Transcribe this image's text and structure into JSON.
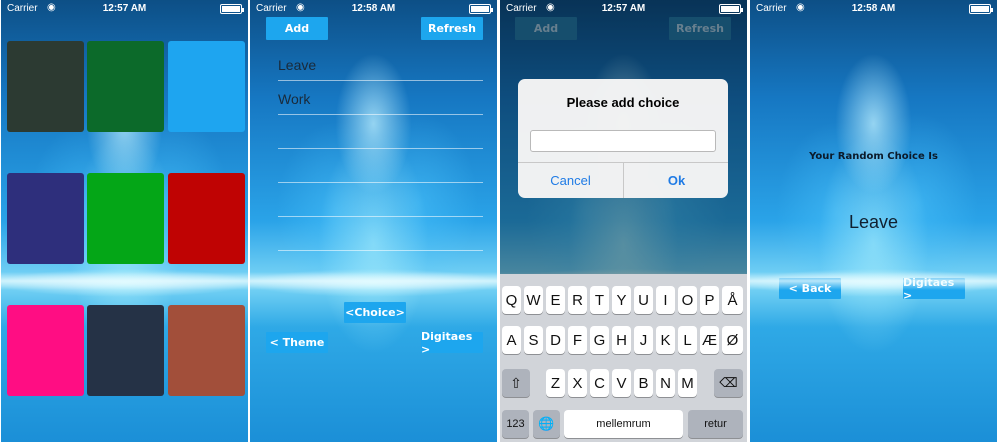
{
  "statusbar": {
    "carrier": "Carrier",
    "wifi_icon": "wifi-icon",
    "times": [
      "12:57 AM",
      "12:58 AM",
      "12:57 AM",
      "12:58 AM"
    ]
  },
  "screen1": {
    "swatches": [
      "#2c3a32",
      "#0c6a2a",
      "#1ea5f0",
      "#2e2f7c",
      "#04a617",
      "#bf0303",
      "#ff0d83",
      "#253246",
      "#a24f3a"
    ]
  },
  "screen2": {
    "add_label": "Add",
    "refresh_label": "Refresh",
    "items": [
      "Leave",
      "Work"
    ],
    "choice_label": "<Choice>",
    "theme_label": "< Theme",
    "digitaes_label": "Digitaes >"
  },
  "screen3": {
    "add_label": "Add",
    "refresh_label": "Refresh",
    "alert": {
      "title": "Please add choice",
      "input_value": "",
      "cancel_label": "Cancel",
      "ok_label": "Ok"
    },
    "keyboard": {
      "row1": [
        "Q",
        "W",
        "E",
        "R",
        "T",
        "Y",
        "U",
        "I",
        "O",
        "P",
        "Å"
      ],
      "row2": [
        "A",
        "S",
        "D",
        "F",
        "G",
        "H",
        "J",
        "K",
        "L",
        "Æ",
        "Ø"
      ],
      "row3": [
        "Z",
        "X",
        "C",
        "V",
        "B",
        "N",
        "M"
      ],
      "shift_icon": "shift-icon",
      "backspace_icon": "backspace-icon",
      "numbers_label": "123",
      "globe_icon": "globe-icon",
      "space_label": "mellemrum",
      "return_label": "retur"
    }
  },
  "screen4": {
    "heading": "Your Random Choice Is",
    "result": "Leave",
    "back_label": "< Back",
    "digitaes_label": "Digitaes >"
  }
}
